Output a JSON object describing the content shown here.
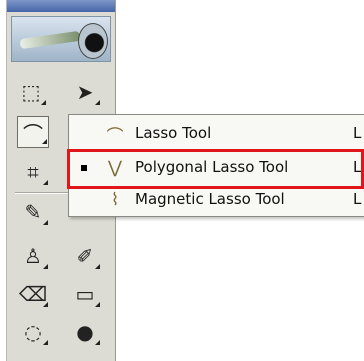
{
  "toolbox": {
    "tools": [
      {
        "name": "rectangular-marquee-tool",
        "glyph": "⬚"
      },
      {
        "name": "move-tool",
        "glyph": "➤"
      },
      {
        "name": "lasso-tool",
        "glyph": "⌒"
      },
      {
        "name": "crop-tool",
        "glyph": "⌗"
      },
      {
        "name": "healing-brush-tool",
        "glyph": "✎"
      },
      {
        "name": "clone-stamp-tool",
        "glyph": "♙"
      },
      {
        "name": "history-brush-tool",
        "glyph": "✐"
      },
      {
        "name": "eraser-tool",
        "glyph": "⌫"
      },
      {
        "name": "gradient-tool",
        "glyph": "▭"
      },
      {
        "name": "blur-tool",
        "glyph": "◌"
      },
      {
        "name": "dodge-tool",
        "glyph": "●"
      }
    ]
  },
  "flyout": {
    "items": [
      {
        "label": "Lasso Tool",
        "shortcut": "L",
        "icon": "lasso-icon",
        "glyph": "⌒",
        "selected": false
      },
      {
        "label": "Polygonal Lasso Tool",
        "shortcut": "L",
        "icon": "polygonal-lasso-icon",
        "glyph": "⋁",
        "selected": true
      },
      {
        "label": "Magnetic Lasso Tool",
        "shortcut": "L",
        "icon": "magnetic-lasso-icon",
        "glyph": "⌇",
        "selected": false
      }
    ]
  },
  "colors": {
    "highlight": "#e0161a"
  }
}
